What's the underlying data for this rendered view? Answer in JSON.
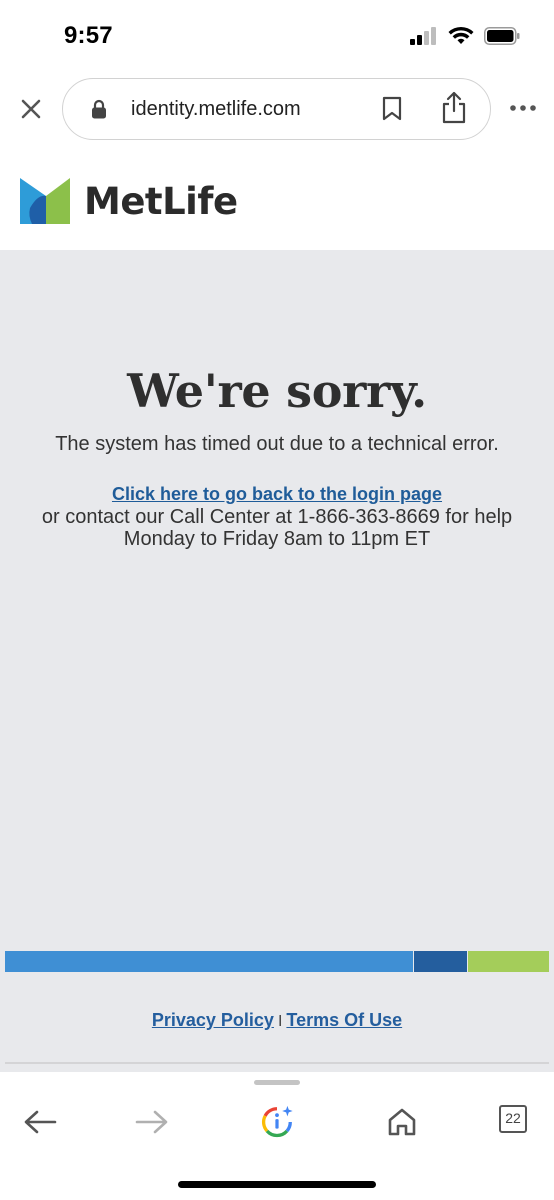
{
  "status": {
    "time": "9:57"
  },
  "browser": {
    "url": "identity.metlife.com",
    "tab_count": "22"
  },
  "site": {
    "brand": "MetLife",
    "colors": {
      "blue": "#3f8fd4",
      "navy": "#245e9e",
      "green": "#a4cd5a",
      "background": "#e8e9ec"
    }
  },
  "error": {
    "title": "We're sorry.",
    "message": "The system has timed out due to a technical error.",
    "login_link": "Click here to go back to the login page",
    "contact": "or contact our Call Center at 1-866-363-8669 for help",
    "hours": "Monday to Friday 8am to 11pm ET"
  },
  "footer": {
    "privacy": "Privacy Policy",
    "separator": "I",
    "terms": "Terms Of Use"
  },
  "icons": [
    "close-icon",
    "lock-icon",
    "bookmark-icon",
    "share-icon",
    "more-icon",
    "back-icon",
    "forward-icon",
    "google-assistant-icon",
    "home-icon",
    "tabs-icon"
  ]
}
